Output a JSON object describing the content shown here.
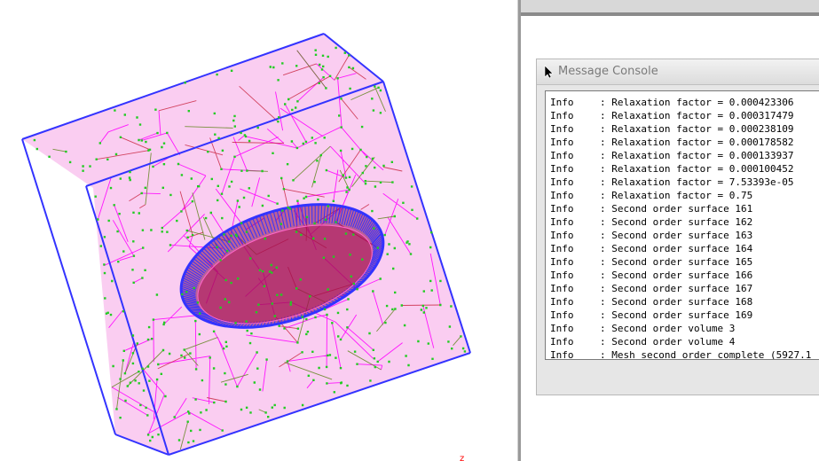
{
  "console": {
    "title": "Message Console",
    "lines": [
      {
        "level": "Info",
        "message": ": Relaxation factor = 0.000423306"
      },
      {
        "level": "Info",
        "message": ": Relaxation factor = 0.000317479"
      },
      {
        "level": "Info",
        "message": ": Relaxation factor = 0.000238109"
      },
      {
        "level": "Info",
        "message": ": Relaxation factor = 0.000178582"
      },
      {
        "level": "Info",
        "message": ": Relaxation factor = 0.000133937"
      },
      {
        "level": "Info",
        "message": ": Relaxation factor = 0.000100452"
      },
      {
        "level": "Info",
        "message": ": Relaxation factor = 7.53393e-05"
      },
      {
        "level": "Info",
        "message": ": Relaxation factor = 0.75"
      },
      {
        "level": "Info",
        "message": ": Second order surface 161"
      },
      {
        "level": "Info",
        "message": ": Second order surface 162"
      },
      {
        "level": "Info",
        "message": ": Second order surface 163"
      },
      {
        "level": "Info",
        "message": ": Second order surface 164"
      },
      {
        "level": "Info",
        "message": ": Second order surface 165"
      },
      {
        "level": "Info",
        "message": ": Second order surface 166"
      },
      {
        "level": "Info",
        "message": ": Second order surface 167"
      },
      {
        "level": "Info",
        "message": ": Second order surface 168"
      },
      {
        "level": "Info",
        "message": ": Second order surface 169"
      },
      {
        "level": "Info",
        "message": ": Second order volume 3"
      },
      {
        "level": "Info",
        "message": ": Second order volume 4"
      },
      {
        "level": "Info",
        "message": ": Mesh second order complete (5927.1"
      }
    ]
  },
  "viewport": {
    "colors": {
      "mesh_primary": "#ff00ff",
      "mesh_secondary": "#c8203c",
      "mesh_green": "#6a8a2a",
      "nodes": "#22cc22",
      "outline": "#3333ff",
      "inner_dark": "#8a0a4a"
    }
  }
}
